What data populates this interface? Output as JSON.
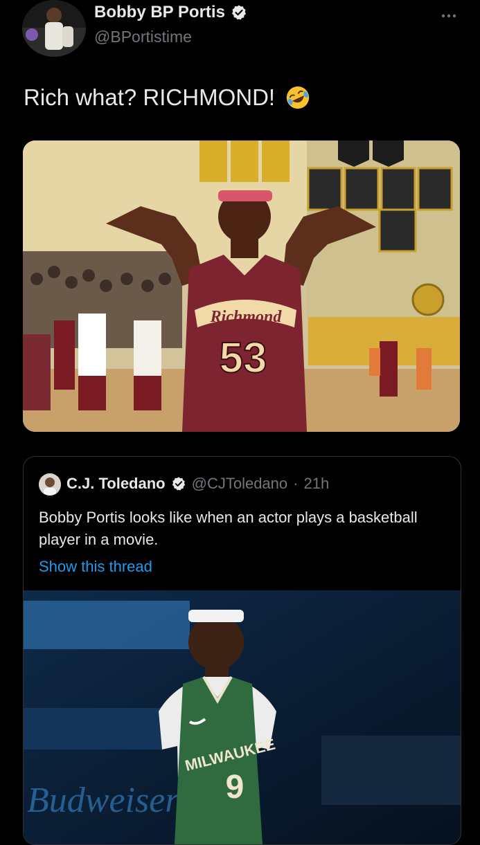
{
  "author": {
    "name": "Bobby BP Portis",
    "handle": "@BPortistime",
    "verified": true
  },
  "menu_icon": "more-horizontal-icon",
  "tweet": {
    "text": "Rich what? RICHMOND!",
    "emoji": "rolling-on-the-floor-laughing"
  },
  "media1": {
    "jersey_text": "Richmond",
    "jersey_number": "53"
  },
  "quoted_tweet": {
    "name": "C.J. Toledano",
    "handle": "@CJToledano",
    "separator": "·",
    "time": "21h",
    "text": "Bobby Portis looks like when an actor plays a basketball player in a movie.",
    "show_thread": "Show this thread",
    "media": {
      "jersey_text": "MILWAUKEE",
      "jersey_number": "9",
      "sign_text": "Budweiser"
    }
  },
  "colors": {
    "background": "#000000",
    "text": "#e7e9ea",
    "muted": "#71767b",
    "link": "#1d9bf0",
    "border": "#2f3336"
  }
}
